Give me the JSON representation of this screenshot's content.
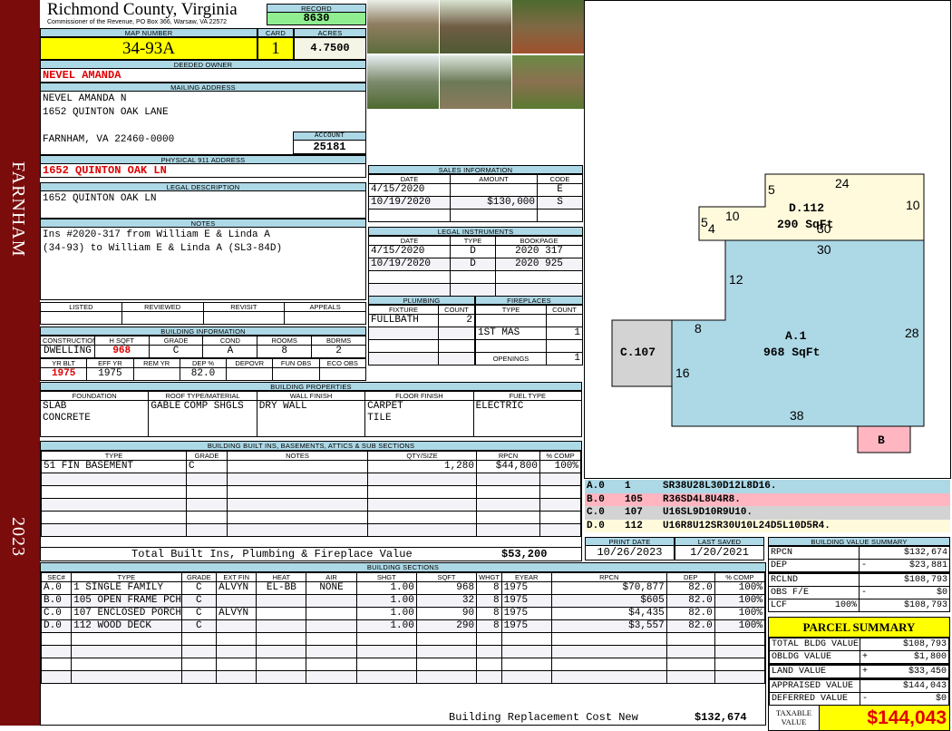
{
  "side": {
    "town": "FARNHAM",
    "year": "2023"
  },
  "header": {
    "title": "Richmond County, Virginia",
    "subtitle": "Commissioner of the Revenue, PO Box 366, Warsaw, VA 22572",
    "record_label": "RECORD",
    "record": "8630"
  },
  "parcel": {
    "map_label": "MAP NUMBER",
    "map": "34-93A",
    "card_label": "CARD",
    "card": "1",
    "acres_label": "ACRES",
    "acres": "4.7500"
  },
  "owner": {
    "label": "DEEDED OWNER",
    "name": "NEVEL AMANDA"
  },
  "mailing": {
    "label": "MAILING ADDRESS",
    "line1": "NEVEL AMANDA N",
    "line2": "1652 QUINTON OAK LANE",
    "line3": "FARNHAM, VA 22460-0000",
    "account_label": "ACCOUNT",
    "account": "25181"
  },
  "physical": {
    "label": "PHYSICAL 911 ADDRESS",
    "address": "1652 QUINTON OAK LN"
  },
  "legal": {
    "label": "LEGAL DESCRIPTION",
    "text": "1652 QUINTON OAK LN"
  },
  "notes": {
    "label": "NOTES",
    "line1": "Ins #2020-317 from William E & Linda A",
    "line2": "(34-93) to William E & Linda A (SL3-84D)"
  },
  "review": {
    "headers": [
      "LISTED",
      "REVIEWED",
      "REVISIT",
      "APPEALS"
    ]
  },
  "building_info": {
    "label": "BUILDING INFORMATION",
    "h1": [
      "CONSTRUCTION STYLE",
      "H SQFT",
      "GRADE",
      "COND",
      "ROOMS",
      "BDRMS"
    ],
    "v1": [
      "DWELLING",
      "968",
      "C",
      "A",
      "8",
      "2"
    ],
    "h2": [
      "YR BLT",
      "EFF YR",
      "REM YR",
      "DEP %",
      "DEPOVR",
      "FUN OBS",
      "ECO OBS"
    ],
    "v2": [
      "1975",
      "1975",
      "",
      "82.0",
      "",
      "",
      ""
    ]
  },
  "sales": {
    "label": "SALES INFORMATION",
    "headers": [
      "DATE",
      "AMOUNT",
      "CODE"
    ],
    "rows": [
      [
        "4/15/2020",
        "",
        "E"
      ],
      [
        "10/19/2020",
        "$130,000",
        "S"
      ]
    ]
  },
  "instruments": {
    "label": "LEGAL INSTRUMENTS",
    "headers": [
      "DATE",
      "TYPE",
      "BOOKPAGE"
    ],
    "rows": [
      [
        "4/15/2020",
        "D",
        "2020 317"
      ],
      [
        "10/19/2020",
        "D",
        "2020 925"
      ]
    ]
  },
  "plumbing": {
    "label": "PLUMBING",
    "headers": [
      "FIXTURE",
      "COUNT"
    ],
    "rows": [
      [
        "FULLBATH",
        "2"
      ]
    ]
  },
  "fireplaces": {
    "label": "FIREPLACES",
    "headers": [
      "TYPE",
      "COUNT"
    ],
    "rows": [
      [
        "1ST MAS",
        "1"
      ]
    ],
    "openings_label": "OPENINGS",
    "openings": "1"
  },
  "properties": {
    "label": "BUILDING PROPERTIES",
    "headers": [
      "FOUNDATION",
      "ROOF TYPE/MATERIAL",
      "WALL FINISH",
      "FLOOR FINISH",
      "FUEL TYPE"
    ],
    "foundation": [
      "SLAB",
      "CONCRETE"
    ],
    "roof_type": "GABLE",
    "roof_material": "COMP SHGLS",
    "wall": "DRY WALL",
    "floor": [
      "CARPET",
      "TILE"
    ],
    "fuel": "ELECTRIC"
  },
  "builtins": {
    "label": "BUILDING BUILT INS, BASEMENTS, ATTICS & SUB SECTIONS",
    "headers": [
      "TYPE",
      "GRADE",
      "NOTES",
      "QTY/SIZE",
      "RPCN",
      "% COMP"
    ],
    "rows": [
      [
        "51 FIN BASEMENT",
        "C",
        "",
        "1,280",
        "$44,800",
        "100%"
      ]
    ],
    "total_label": "Total Built Ins, Plumbing & Fireplace Value",
    "total": "$53,200"
  },
  "dates": {
    "print_label": "PRINT DATE",
    "print": "10/26/2023",
    "saved_label": "LAST SAVED",
    "saved": "1/20/2021"
  },
  "sections": {
    "label": "BUILDING SECTIONS",
    "headers": [
      "SEC#",
      "TYPE",
      "GRADE",
      "EXT FIN",
      "HEAT",
      "AIR",
      "SHGT",
      "SQFT",
      "WHGT",
      "EYEAR",
      "RPCN",
      "DEP",
      "% COMP"
    ],
    "rows": [
      [
        "A.0",
        "1 SINGLE FAMILY",
        "C",
        "ALVYN",
        "EL-BB",
        "NONE",
        "1.00",
        "968",
        "8",
        "1975",
        "$70,877",
        "82.0",
        "100%"
      ],
      [
        "B.0",
        "105 OPEN FRAME PCH",
        "C",
        "",
        "",
        "",
        "1.00",
        "32",
        "8",
        "1975",
        "$605",
        "82.0",
        "100%"
      ],
      [
        "C.0",
        "107 ENCLOSED PORCH",
        "C",
        "ALVYN",
        "",
        "",
        "1.00",
        "90",
        "8",
        "1975",
        "$4,435",
        "82.0",
        "100%"
      ],
      [
        "D.0",
        "112 WOOD DECK",
        "C",
        "",
        "",
        "",
        "1.00",
        "290",
        "8",
        "1975",
        "$3,557",
        "82.0",
        "100%"
      ]
    ],
    "total_label": "Building Replacement Cost New",
    "total": "$132,674"
  },
  "sketch": {
    "labels": {
      "a": "A.1",
      "a_area": "968 SqFt",
      "c": "C.107",
      "b": "B",
      "d": "D.112",
      "d_area": "290 SqFt"
    },
    "dims": [
      "24",
      "5",
      "10",
      "5",
      "4",
      "10",
      "30",
      "30",
      "12",
      "8",
      "28",
      "16",
      "38"
    ],
    "legend": [
      {
        "sec": "A.0",
        "code": "1",
        "path": "SR38U28L30D12L8D16.",
        "color": "#add8e6"
      },
      {
        "sec": "B.0",
        "code": "105",
        "path": "R36SD4L8U4R8.",
        "color": "#ffb6c1"
      },
      {
        "sec": "C.0",
        "code": "107",
        "path": "U16SL9D10R9U10.",
        "color": "#d3d3d3"
      },
      {
        "sec": "D.0",
        "code": "112",
        "path": "U16R8U12SR30U10L24D5L10D5R4.",
        "color": "#fffadc"
      }
    ]
  },
  "value_summary": {
    "label": "BUILDING VALUE SUMMARY",
    "rows": [
      [
        "RPCN",
        "",
        "$132,674"
      ],
      [
        "DEP",
        "-",
        "$23,881"
      ],
      [
        "RCLND",
        "",
        "$108,793"
      ],
      [
        "OBS F/E",
        "-",
        "$0"
      ],
      [
        "LCF",
        "100%",
        "$108,793"
      ]
    ]
  },
  "parcel_summary": {
    "label": "PARCEL SUMMARY",
    "rows": [
      [
        "TOTAL BLDG VALUE",
        "",
        "$108,793"
      ],
      [
        "OBLDG VALUE",
        "+",
        "$1,800"
      ],
      [
        "LAND VALUE",
        "+",
        "$33,450"
      ],
      [
        "APPRAISED VALUE",
        "",
        "$144,043"
      ],
      [
        "DEFERRED VALUE",
        "-",
        "$0"
      ]
    ],
    "taxable_label": "TAXABLE VALUE",
    "taxable": "$144,043"
  }
}
